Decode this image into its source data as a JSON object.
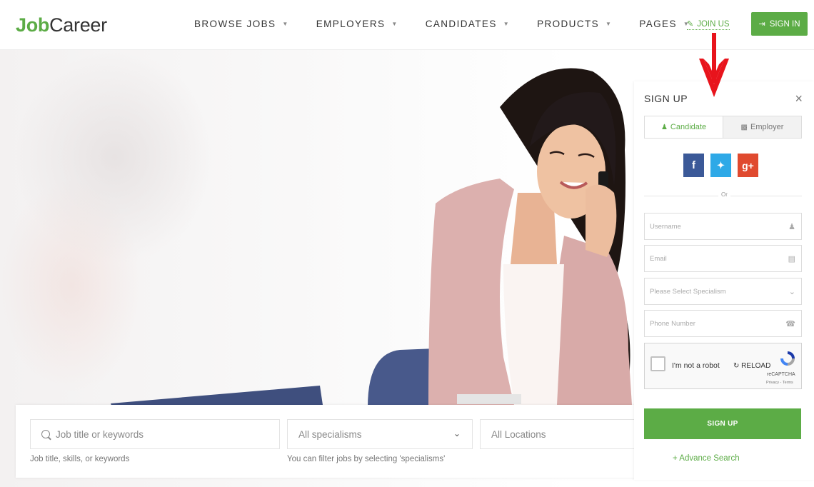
{
  "header": {
    "logo_bold": "Job",
    "logo_rest": "Career",
    "nav": [
      {
        "label": "BROWSE JOBS"
      },
      {
        "label": "EMPLOYERS"
      },
      {
        "label": "CANDIDATES"
      },
      {
        "label": "PRODUCTS"
      },
      {
        "label": "PAGES"
      }
    ],
    "join_label": "JOIN US",
    "signin_label": "SIGN IN"
  },
  "signup": {
    "title": "SIGN UP",
    "close": "×",
    "tabs": [
      {
        "label": "Candidate",
        "active": true
      },
      {
        "label": "Employer",
        "active": false
      }
    ],
    "or_text": "Or",
    "fields": [
      {
        "placeholder": "Username",
        "icon": "user-icon"
      },
      {
        "placeholder": "Email",
        "icon": "envelope-icon"
      },
      {
        "placeholder": "Please Select Specialism",
        "icon": "chevron-down-icon"
      },
      {
        "placeholder": "Phone Number",
        "icon": "phone-icon"
      }
    ],
    "captcha": {
      "label": "I'm not a robot",
      "reload": "RELOAD",
      "brand": "reCAPTCHA",
      "terms": "Privacy - Terms"
    },
    "submit_label": "SIGN UP",
    "advance_search": "+ Advance Search"
  },
  "search": {
    "keyword_placeholder": "Job title or keywords",
    "keyword_hint": "Job title, skills, or keywords",
    "specialism_value": "All specialisms",
    "specialism_hint": "You can filter jobs by selecting 'specialisms'",
    "location_value": "All Locations"
  },
  "colors": {
    "accent": "#5cac46",
    "facebook": "#3b5998",
    "twitter": "#2ea9e7",
    "google": "#e04a2f",
    "arrow": "#e8141c"
  }
}
